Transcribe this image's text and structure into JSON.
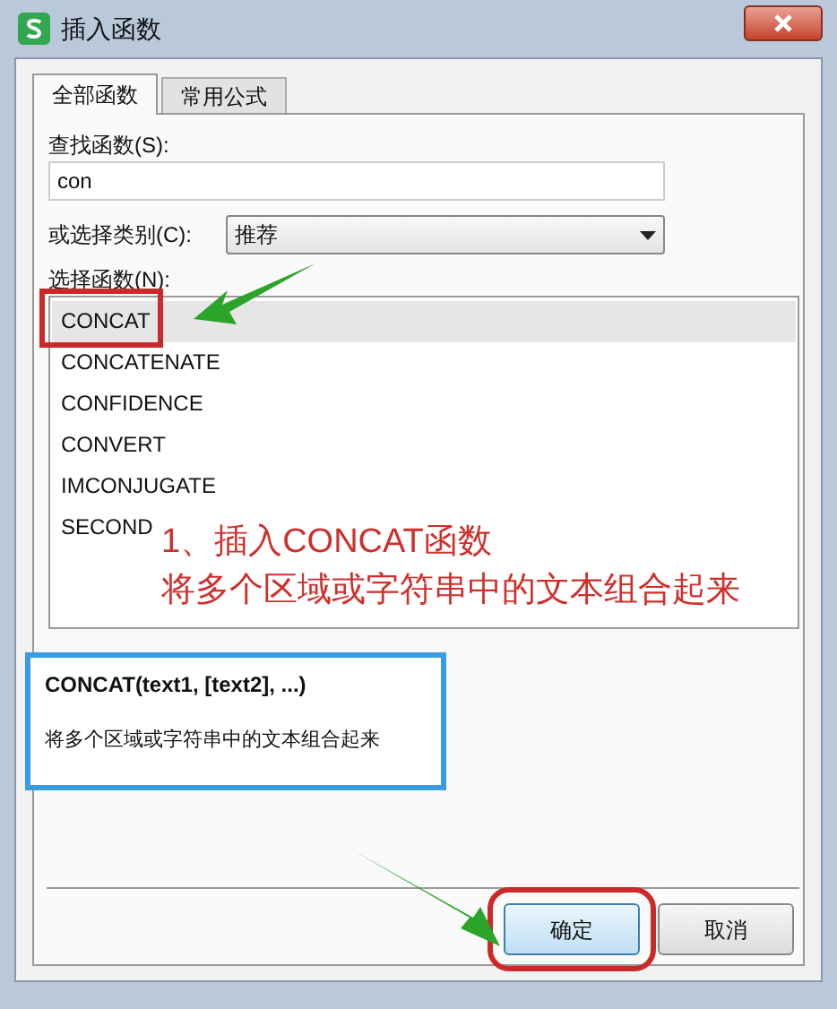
{
  "window": {
    "title": "插入函数"
  },
  "tabs": [
    {
      "label": "全部函数",
      "selected": true
    },
    {
      "label": "常用公式",
      "selected": false
    }
  ],
  "search": {
    "label": "查找函数(S):",
    "value": "con"
  },
  "category": {
    "label": "或选择类别(C):",
    "value": "推荐"
  },
  "function_list": {
    "label": "选择函数(N):",
    "items": [
      {
        "name": "CONCAT",
        "selected": true
      },
      {
        "name": "CONCATENATE",
        "selected": false
      },
      {
        "name": "CONFIDENCE",
        "selected": false
      },
      {
        "name": "CONVERT",
        "selected": false
      },
      {
        "name": "IMCONJUGATE",
        "selected": false
      },
      {
        "name": "SECOND",
        "selected": false
      }
    ]
  },
  "annotation": {
    "lines": [
      "1、插入CONCAT函数",
      "将多个区域或字符串中的文本组合起来"
    ]
  },
  "description": {
    "signature": "CONCAT(text1, [text2], ...)",
    "text": "将多个区域或字符串中的文本组合起来"
  },
  "buttons": [
    {
      "label": "确定",
      "highlighted": true
    },
    {
      "label": "取消",
      "highlighted": false
    }
  ]
}
